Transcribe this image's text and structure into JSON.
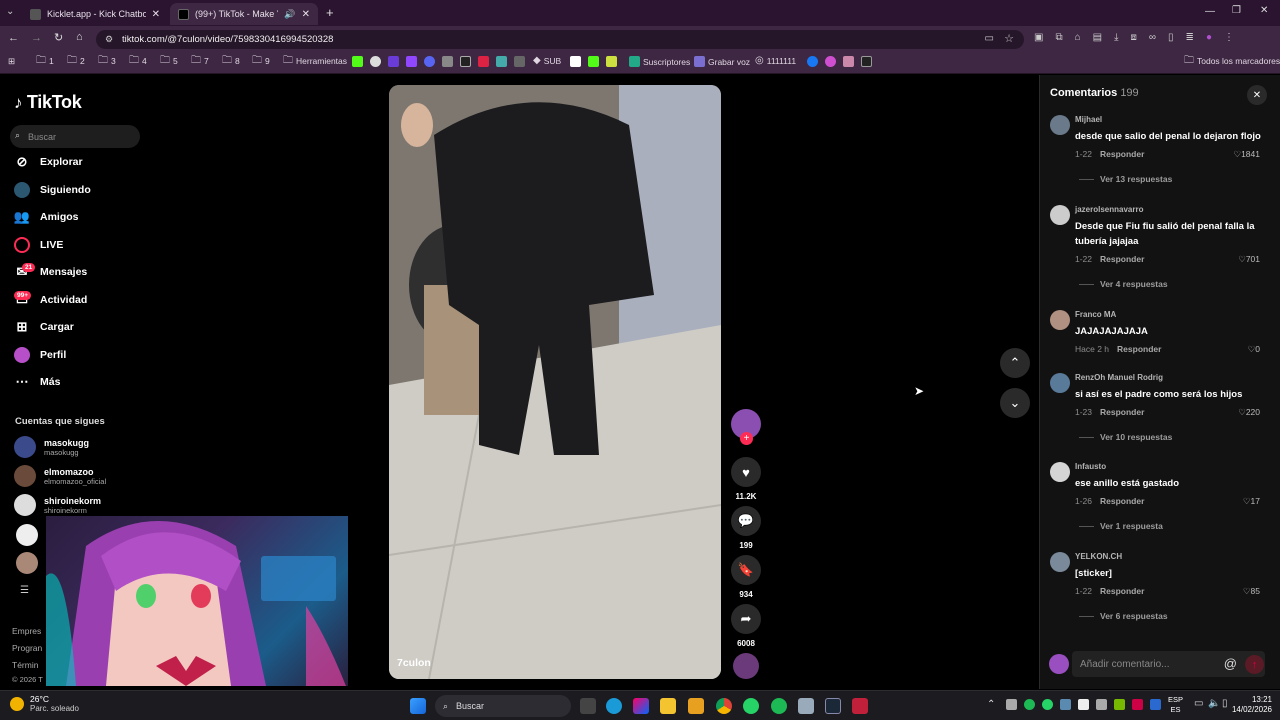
{
  "browser": {
    "tabs": [
      {
        "label": "Kicklet.app - Kick Chatbot and"
      },
      {
        "label": "(99+) TikTok - Make Your D"
      }
    ],
    "url": "tiktok.com/@7culon/video/7598330416994520328",
    "bookmarks": [
      "1",
      "2",
      "3",
      "4",
      "5",
      "7",
      "8",
      "9",
      "Herramientas",
      "SUB",
      "Suscriptores",
      "Grabar voz",
      "1111111"
    ],
    "bookmarks_all": "Todos los marcadores"
  },
  "sidebar": {
    "logo": "TikTok",
    "search_placeholder": "Buscar",
    "nav": [
      {
        "label": "Explorar",
        "icon": "compass-icon"
      },
      {
        "label": "Siguiendo",
        "icon": "following-icon"
      },
      {
        "label": "Amigos",
        "icon": "friends-icon"
      },
      {
        "label": "LIVE",
        "icon": "live-icon"
      },
      {
        "label": "Mensajes",
        "icon": "messages-icon",
        "badge": "21"
      },
      {
        "label": "Actividad",
        "icon": "activity-icon",
        "badge": "99+"
      },
      {
        "label": "Cargar",
        "icon": "upload-icon"
      },
      {
        "label": "Perfil",
        "icon": "profile-icon"
      },
      {
        "label": "Más",
        "icon": "more-icon"
      }
    ],
    "following_title": "Cuentas que sigues",
    "following": [
      {
        "name": "masokugg",
        "handle": "masokugg"
      },
      {
        "name": "elmomazoo",
        "handle": "elmomazoo_oficial"
      },
      {
        "name": "shiroinekorm",
        "handle": "shiroinekorm"
      }
    ],
    "footer": [
      "Empres",
      "Progran",
      "Términ",
      "© 2026 T"
    ]
  },
  "video": {
    "author": "7culon",
    "likes": "11.2K",
    "comments": "199",
    "saves": "934",
    "shares": "6008"
  },
  "comments_panel": {
    "title": "Comentarios",
    "count": "199",
    "items": [
      {
        "user": "Mijhael",
        "text": "desde que salio del penal lo dejaron flojo",
        "date": "1-22",
        "reply": "Responder",
        "likes": "1841",
        "more": "Ver 13 respuestas"
      },
      {
        "user": "jazerolsennavarro",
        "text": "Desde que Fiu fiu salió del penal falla la tubería jajajaa",
        "date": "1-22",
        "reply": "Responder",
        "likes": "701",
        "more": "Ver 4 respuestas"
      },
      {
        "user": "Franco MA",
        "text": "JAJAJAJAJAJA",
        "date": "Hace 2 h",
        "reply": "Responder",
        "likes": "0",
        "more": ""
      },
      {
        "user": "RenzOh Manuel Rodrig",
        "text": "si así es el padre como será los hijos",
        "date": "1-23",
        "reply": "Responder",
        "likes": "220",
        "more": "Ver 10 respuestas"
      },
      {
        "user": "Infausto",
        "text": "ese anillo está gastado",
        "date": "1-26",
        "reply": "Responder",
        "likes": "17",
        "more": "Ver 1 respuesta"
      },
      {
        "user": "YELKON.CH",
        "text": "[sticker]",
        "date": "1-22",
        "reply": "Responder",
        "likes": "85",
        "more": "Ver 6 respuestas"
      }
    ],
    "add_placeholder": "Añadir comentario..."
  },
  "taskbar": {
    "weather_temp": "26°C",
    "weather_desc": "Parc. soleado",
    "search": "Buscar",
    "lang1": "ESP",
    "lang2": "ES",
    "time": "13:21",
    "date": "14/02/2026"
  },
  "colors": {
    "accent": "#fe2c55",
    "tab_bg": "#2a1430",
    "toolbar_bg": "#3d2742"
  }
}
